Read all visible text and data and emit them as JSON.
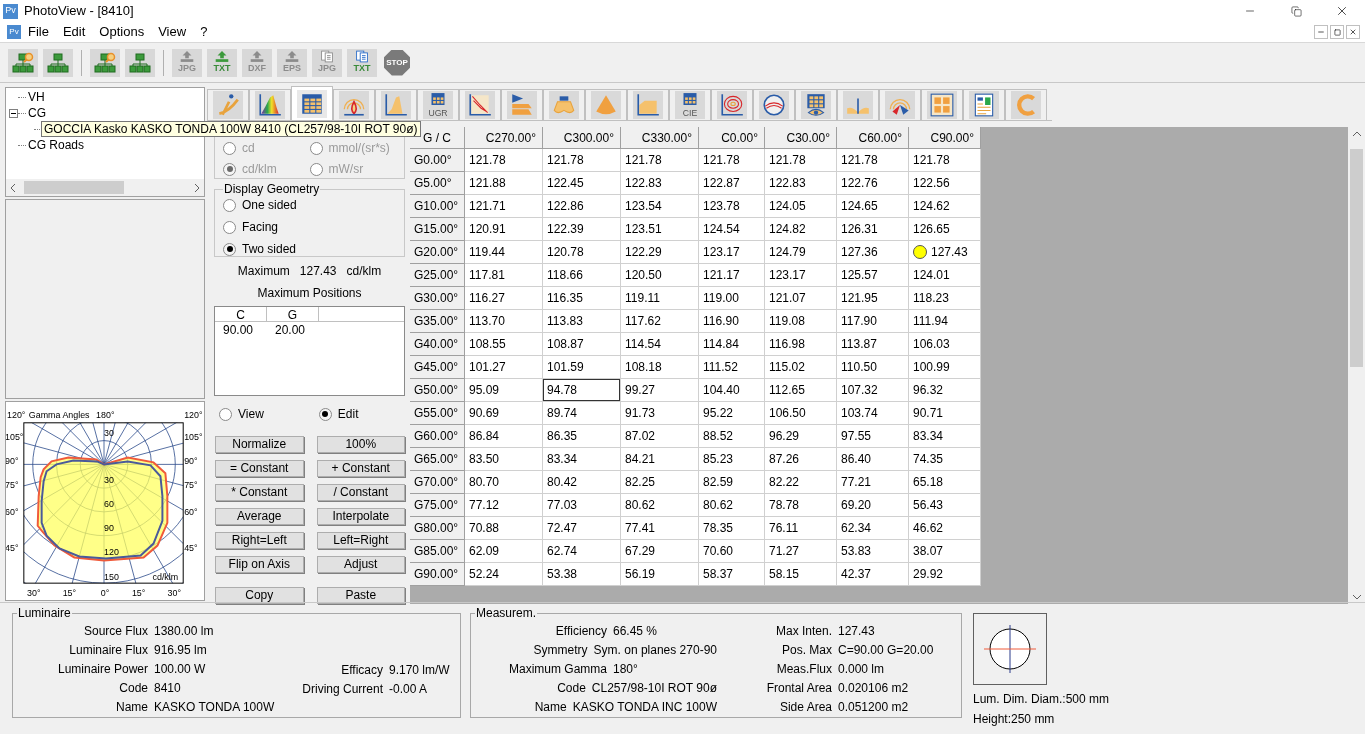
{
  "window": {
    "title": "PhotoView - [8410]",
    "app_icon": "Pv"
  },
  "menu": {
    "app_icon": "Pv",
    "items": [
      "File",
      "Edit",
      "Options",
      "View",
      "?"
    ]
  },
  "toolbar": [
    {
      "kind": "network-search"
    },
    {
      "kind": "network"
    },
    {
      "kind": "separator"
    },
    {
      "kind": "network-search"
    },
    {
      "kind": "network"
    },
    {
      "kind": "separator"
    },
    {
      "kind": "export",
      "label": "JPG",
      "disabled": true
    },
    {
      "kind": "export",
      "label": "TXT",
      "disabled": false
    },
    {
      "kind": "export",
      "label": "DXF",
      "disabled": true
    },
    {
      "kind": "export",
      "label": "EPS",
      "disabled": true
    },
    {
      "kind": "document",
      "label": "JPG",
      "disabled": true
    },
    {
      "kind": "document",
      "label": "TXT",
      "disabled": false
    },
    {
      "kind": "stop",
      "label": "STOP",
      "disabled": true
    }
  ],
  "tree": [
    {
      "label": "VH"
    },
    {
      "label": "CG",
      "expanded": true,
      "children": [
        {
          "label": "GOCCIA Kasko KASKO TONDA 100W 8410 (CL257/98-10I ROT 90ø)",
          "tooltip": true
        }
      ]
    },
    {
      "label": "CG Roads"
    }
  ],
  "polar_chart": {
    "title": "Gamma Angles",
    "top": [
      "120°",
      "180°",
      "120°"
    ],
    "left": [
      "105°",
      "90°",
      "75°",
      "60°",
      "45°"
    ],
    "right": [
      "105°",
      "90°",
      "75°",
      "60°",
      "45°"
    ],
    "radial": [
      "30",
      "30",
      "60",
      "90",
      "120",
      "150"
    ],
    "unit": "cd/klm",
    "bottom": [
      "30°",
      "15°",
      "0°",
      "15°",
      "30°"
    ]
  },
  "tabs": [
    {
      "kind": "info",
      "selected": false
    },
    {
      "kind": "spectrum",
      "selected": false
    },
    {
      "kind": "table",
      "selected": true
    },
    {
      "kind": "isolux",
      "selected": false
    },
    {
      "kind": "curve",
      "selected": false
    },
    {
      "kind": "ugr",
      "label": "UGR",
      "selected": false
    },
    {
      "kind": "diagram",
      "selected": false
    },
    {
      "kind": "flag",
      "selected": false
    },
    {
      "kind": "lamp",
      "selected": false
    },
    {
      "kind": "cone",
      "selected": false
    },
    {
      "kind": "step",
      "selected": false
    },
    {
      "kind": "cie",
      "label": "CIE",
      "selected": false
    },
    {
      "kind": "target",
      "selected": false
    },
    {
      "kind": "sphere",
      "selected": false
    },
    {
      "kind": "eye-grid",
      "selected": false
    },
    {
      "kind": "dip",
      "selected": false
    },
    {
      "kind": "color-polar",
      "selected": false
    },
    {
      "kind": "grid",
      "selected": false
    },
    {
      "kind": "report",
      "selected": false
    },
    {
      "kind": "letter-c",
      "selected": false
    }
  ],
  "units": {
    "disabled": true,
    "options": [
      {
        "label": "cd",
        "selected": false
      },
      {
        "label": "mmol/(sr*s)",
        "selected": false
      },
      {
        "label": "cd/klm",
        "selected": true
      },
      {
        "label": "mW/sr",
        "selected": false
      }
    ]
  },
  "display_geometry": {
    "title": "Display Geometry",
    "options": [
      {
        "label": "One sided",
        "selected": false
      },
      {
        "label": "Facing",
        "selected": false
      },
      {
        "label": "Two sided",
        "selected": true
      }
    ]
  },
  "maximum": {
    "label": "Maximum",
    "value": "127.43",
    "unit": "cd/klm"
  },
  "maximum_positions": {
    "title": "Maximum Positions",
    "columns": [
      "C",
      "G"
    ],
    "rows": [
      [
        "90.00",
        "20.00"
      ]
    ]
  },
  "mode": [
    {
      "label": "View",
      "selected": false
    },
    {
      "label": "Edit",
      "selected": true
    }
  ],
  "buttons": [
    "Normalize",
    "100%",
    "= Constant",
    "+ Constant",
    "* Constant",
    "/ Constant",
    "Average",
    "Interpolate",
    "Right=Left",
    "Left=Right",
    "Flip on Axis",
    "Adjust",
    "Copy",
    "Paste"
  ],
  "table": {
    "corner": "G / C",
    "columns": [
      "C270.00°",
      "C300.00°",
      "C330.00°",
      "C0.00°",
      "C30.00°",
      "C60.00°",
      "C90.00°"
    ],
    "rows": [
      {
        "label": "G0.00°",
        "cells": [
          "121.78",
          "121.78",
          "121.78",
          "121.78",
          "121.78",
          "121.78",
          "121.78"
        ]
      },
      {
        "label": "G5.00°",
        "cells": [
          "121.88",
          "122.45",
          "122.83",
          "122.87",
          "122.83",
          "122.76",
          "122.56"
        ]
      },
      {
        "label": "G10.00°",
        "cells": [
          "121.71",
          "122.86",
          "123.54",
          "123.78",
          "124.05",
          "124.65",
          "124.62"
        ]
      },
      {
        "label": "G15.00°",
        "cells": [
          "120.91",
          "122.39",
          "123.51",
          "124.54",
          "124.82",
          "126.31",
          "126.65"
        ]
      },
      {
        "label": "G20.00°",
        "cells": [
          "119.44",
          "120.78",
          "122.29",
          "123.17",
          "124.79",
          "127.36",
          {
            "text": "127.43",
            "kind": "maximum"
          }
        ]
      },
      {
        "label": "G25.00°",
        "cells": [
          "117.81",
          "118.66",
          "120.50",
          "121.17",
          "123.17",
          "125.57",
          "124.01"
        ]
      },
      {
        "label": "G30.00°",
        "cells": [
          "116.27",
          "116.35",
          "119.11",
          "119.00",
          "121.07",
          "121.95",
          "118.23"
        ]
      },
      {
        "label": "G35.00°",
        "cells": [
          "113.70",
          "113.83",
          "117.62",
          "116.90",
          "119.08",
          "117.90",
          "111.94"
        ]
      },
      {
        "label": "G40.00°",
        "cells": [
          "108.55",
          "108.87",
          "114.54",
          "114.84",
          "116.98",
          "113.87",
          "106.03"
        ]
      },
      {
        "label": "G45.00°",
        "cells": [
          "101.27",
          "101.59",
          "108.18",
          "111.52",
          "115.02",
          "110.50",
          "100.99"
        ]
      },
      {
        "label": "G50.00°",
        "cells": [
          "95.09",
          {
            "text": "94.78",
            "kind": "editing"
          },
          "99.27",
          "104.40",
          "112.65",
          "107.32",
          "96.32"
        ]
      },
      {
        "label": "G55.00°",
        "cells": [
          "90.69",
          "89.74",
          "91.73",
          "95.22",
          "106.50",
          "103.74",
          "90.71"
        ]
      },
      {
        "label": "G60.00°",
        "cells": [
          "86.84",
          "86.35",
          "87.02",
          "88.52",
          "96.29",
          "97.55",
          "83.34"
        ]
      },
      {
        "label": "G65.00°",
        "cells": [
          "83.50",
          "83.34",
          "84.21",
          "85.23",
          "87.26",
          "86.40",
          "74.35"
        ]
      },
      {
        "label": "G70.00°",
        "cells": [
          "80.70",
          "80.42",
          "82.25",
          "82.59",
          "82.22",
          "77.21",
          "65.18"
        ]
      },
      {
        "label": "G75.00°",
        "cells": [
          "77.12",
          "77.03",
          "80.62",
          "80.62",
          "78.78",
          "69.20",
          "56.43"
        ]
      },
      {
        "label": "G80.00°",
        "cells": [
          "70.88",
          "72.47",
          "77.41",
          "78.35",
          "76.11",
          "62.34",
          "46.62"
        ]
      },
      {
        "label": "G85.00°",
        "cells": [
          "62.09",
          "62.74",
          "67.29",
          "70.60",
          "71.27",
          "53.83",
          "38.07"
        ]
      },
      {
        "label": "G90.00°",
        "cells": [
          "52.24",
          "53.38",
          "56.19",
          "58.37",
          "58.15",
          "42.37",
          "29.92"
        ]
      }
    ]
  },
  "luminaire": {
    "title": "Luminaire",
    "fields": [
      {
        "label": "Source Flux",
        "value": "1380.00 lm"
      },
      {
        "label": "Luminaire Flux",
        "value": "916.95 lm"
      },
      {
        "label": "Luminaire Power",
        "value": "100.00 W"
      },
      {
        "label": "Code",
        "value": "8410"
      },
      {
        "label": "Name",
        "value": "KASKO TONDA 100W"
      }
    ],
    "electrical": [
      {
        "label": "Efficacy",
        "value": "9.170 lm/W"
      },
      {
        "label": "Driving Current",
        "value": "-0.00 A"
      }
    ]
  },
  "measurement": {
    "title": "Measurem.",
    "left": [
      {
        "label": "Efficiency",
        "value": "66.45 %"
      },
      {
        "label": "Symmetry",
        "value": "Sym. on planes 270-90"
      },
      {
        "label": "Maximum Gamma",
        "value": "180°"
      },
      {
        "label": "Code",
        "value": "CL257/98-10I ROT 90ø"
      },
      {
        "label": "Name",
        "value": "KASKO TONDA INC 100W"
      }
    ],
    "right": [
      {
        "label": "Max Inten.",
        "value": "127.43"
      },
      {
        "label": "Pos. Max",
        "value": "C=90.00 G=20.00"
      },
      {
        "label": "Meas.Flux",
        "value": "0.000 lm"
      },
      {
        "label": "Frontal Area",
        "value": "0.020106 m2"
      },
      {
        "label": "Side Area",
        "value": "0.051200 m2"
      }
    ]
  },
  "dimensions": {
    "diameter": "Lum. Dim. Diam.:500 mm",
    "height": "Height:250 mm"
  }
}
